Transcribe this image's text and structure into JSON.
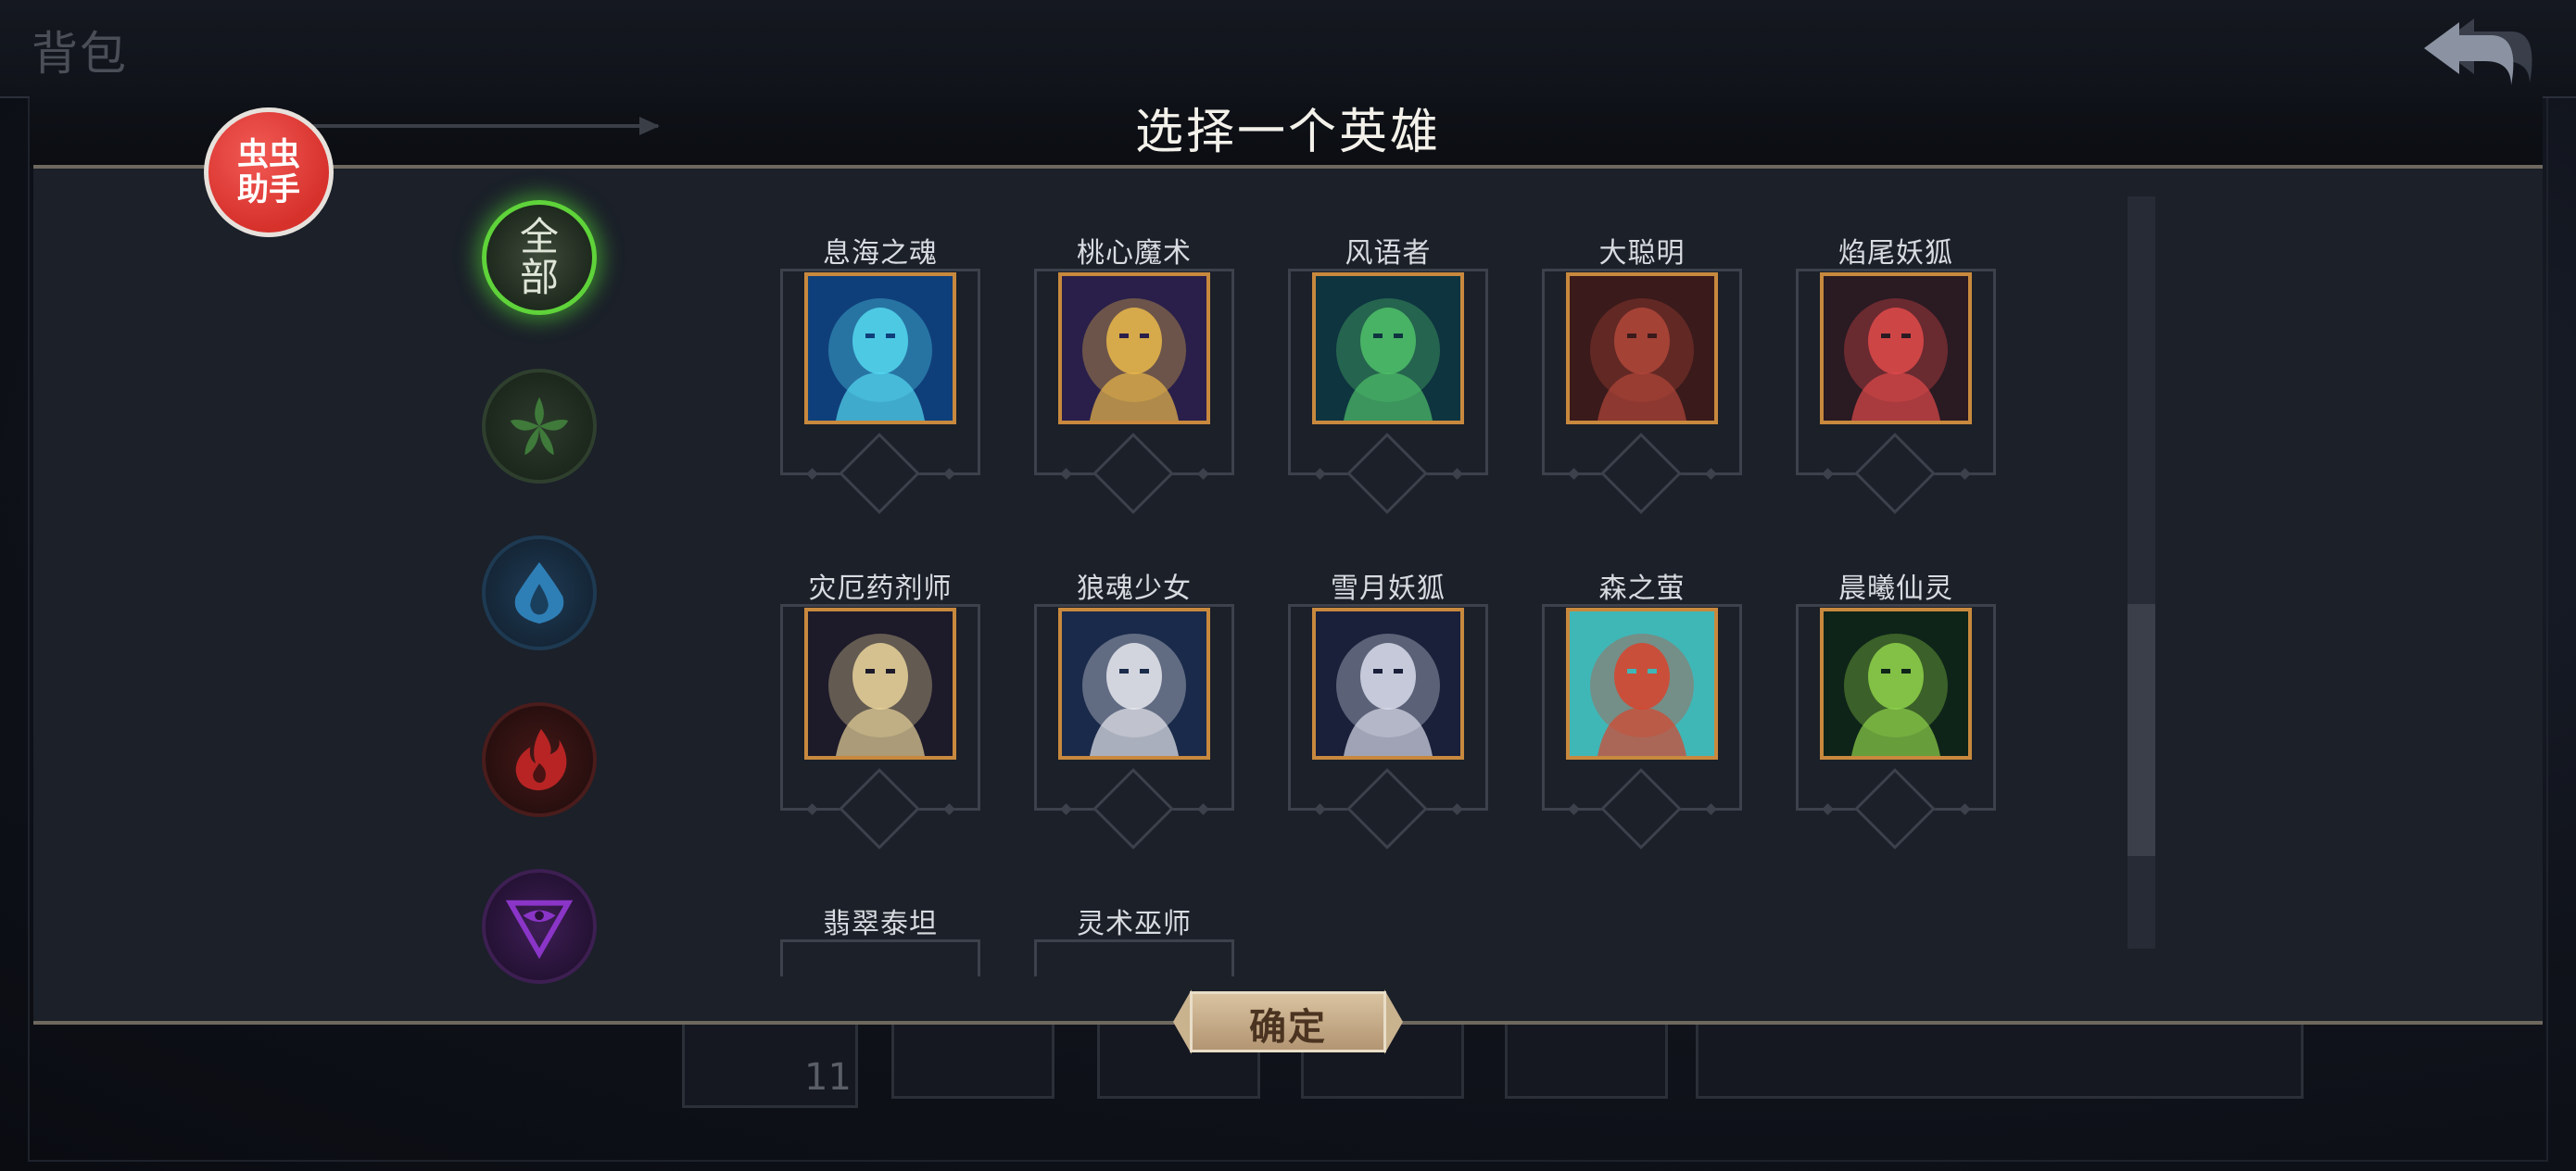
{
  "background": {
    "bag_title": "背包",
    "item_count": "11"
  },
  "dialog": {
    "title": "选择一个英雄",
    "confirm_label": "确定"
  },
  "helper_badge": {
    "line1": "虫虫",
    "line2": "助手"
  },
  "filters": [
    {
      "id": "all",
      "label": "全部",
      "icon": "all-text-icon",
      "selected": true,
      "color": "#5fd33a"
    },
    {
      "id": "nature",
      "icon": "leaf-icon",
      "selected": false,
      "color": "#3f7a3a"
    },
    {
      "id": "water",
      "icon": "water-drop-icon",
      "selected": false,
      "color": "#2f7fb7"
    },
    {
      "id": "fire",
      "icon": "flame-icon",
      "selected": false,
      "color": "#c12a2a"
    },
    {
      "id": "dark",
      "icon": "triangle-eye-icon",
      "selected": false,
      "color": "#8a35c7"
    }
  ],
  "heroes": [
    {
      "name": "息海之魂",
      "portrait": "blue-spirit",
      "colors": [
        "#0f3f7a",
        "#55d8f0"
      ]
    },
    {
      "name": "桃心魔术",
      "portrait": "masked-magician",
      "colors": [
        "#2a1f4a",
        "#e9b84a"
      ]
    },
    {
      "name": "风语者",
      "portrait": "green-elf",
      "colors": [
        "#0e3440",
        "#4fbf6a"
      ]
    },
    {
      "name": "大聪明",
      "portrait": "horned-warrior",
      "colors": [
        "#3a1a1a",
        "#b0463a"
      ]
    },
    {
      "name": "焰尾妖狐",
      "portrait": "fox-girl-mask",
      "colors": [
        "#2a1a22",
        "#e04a4a"
      ]
    },
    {
      "name": "灾厄药剂师",
      "portrait": "veiled-alchemist",
      "colors": [
        "#1d1a2a",
        "#e8d39a"
      ]
    },
    {
      "name": "狼魂少女",
      "portrait": "wolf-girl",
      "colors": [
        "#1a2a4a",
        "#e8e8ee"
      ]
    },
    {
      "name": "雪月妖狐",
      "portrait": "snow-fox",
      "colors": [
        "#1a1f3a",
        "#d8dcea"
      ]
    },
    {
      "name": "森之萤",
      "portrait": "forest-firefly",
      "colors": [
        "#3fb7b7",
        "#d8442e"
      ]
    },
    {
      "name": "晨曦仙灵",
      "portrait": "leaf-sprite",
      "colors": [
        "#0e2418",
        "#8fd24a"
      ]
    },
    {
      "name": "翡翠泰坦",
      "portrait": "partial",
      "colors": [
        "#1b2029",
        "#1b2029"
      ]
    },
    {
      "name": "灵术巫师",
      "portrait": "partial",
      "colors": [
        "#1b2029",
        "#1b2029"
      ]
    }
  ],
  "scrollbar": {
    "position": 0.6
  }
}
